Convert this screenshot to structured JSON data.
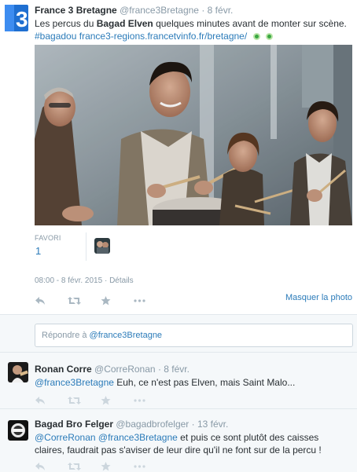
{
  "colors": {
    "link": "#2b7bb9",
    "muted": "#8899a6",
    "text": "#292f33",
    "france3_blue": "#1f6fd1"
  },
  "main_tweet": {
    "fullname": "France 3 Bretagne",
    "handle": "@france3Bretagne",
    "separator": "·",
    "date": "8 févr.",
    "text_before": "Les percus du ",
    "text_bold": "Bagad Elven",
    "text_after": " quelques minutes avant de monter sur scène.",
    "hashtag": "#bagadou",
    "url": "france3-regions.francetvinfo.fr/bretagne/",
    "stat_label": "FAVORI",
    "stat_value": "1",
    "timestamp": "08:00 - 8 févr. 2015",
    "details_separator": "·",
    "details_link": "Détails",
    "hide_photo": "Masquer la photo"
  },
  "reply_box": {
    "prefix": "Répondre à ",
    "mention": "@france3Bretagne"
  },
  "replies": [
    {
      "fullname": "Ronan Corre",
      "handle": "@CorreRonan",
      "separator": "·",
      "date": "8 févr.",
      "mention": "@france3Bretagne",
      "text": " Euh, ce n'est pas Elven, mais Saint Malo..."
    },
    {
      "fullname": "Bagad Bro Felger",
      "handle": "@bagadbrofelger",
      "separator": "·",
      "date": "13 févr.",
      "mention1": "@CorreRonan",
      "mention2": "@france3Bretagne",
      "text": " et puis ce sont plutôt des caisses claires, faudrait pas s'aviser de leur dire qu'il ne font sur de la percu !"
    }
  ],
  "icons": [
    "france3-logo-icon",
    "reply-icon",
    "retweet-icon",
    "favorite-icon",
    "more-icon",
    "vine-dot-icon"
  ]
}
